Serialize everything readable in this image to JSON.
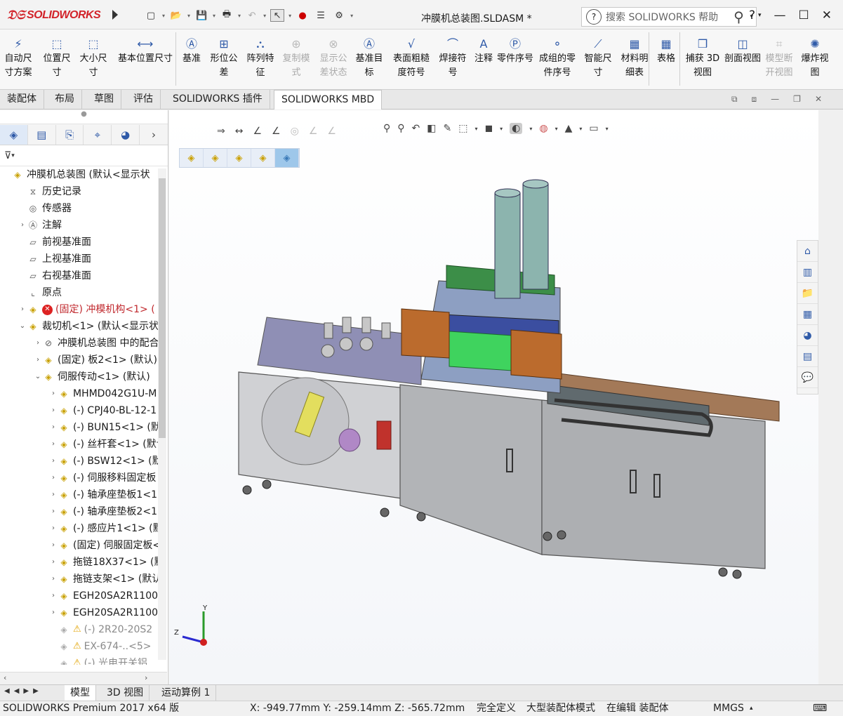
{
  "app": {
    "logo": "SOLIDWORKS",
    "doc_title": "冲膜机总装图.SLDASM *"
  },
  "search": {
    "placeholder": "搜索 SOLIDWORKS 帮助"
  },
  "ribbon": [
    {
      "label": "自动尺寸方案",
      "icon": "auto-dimension-icon",
      "enabled": true
    },
    {
      "label": "位置尺寸",
      "icon": "location-dimension-icon",
      "enabled": true
    },
    {
      "label": "大小尺寸",
      "icon": "size-dimension-icon",
      "enabled": true
    },
    {
      "label": "基本位置尺寸",
      "icon": "basic-location-dimension-icon",
      "enabled": true
    },
    {
      "label": "基准",
      "icon": "datum-icon",
      "enabled": true
    },
    {
      "label": "形位公差",
      "icon": "gtol-icon",
      "enabled": true
    },
    {
      "label": "阵列特征",
      "icon": "pattern-feature-icon",
      "enabled": true
    },
    {
      "label": "复制模式",
      "icon": "copy-scheme-icon",
      "enabled": false
    },
    {
      "label": "显示公差状态",
      "icon": "show-tolerance-status-icon",
      "enabled": false
    },
    {
      "label": "基准目标",
      "icon": "datum-target-icon",
      "enabled": true
    },
    {
      "label": "表面粗糙度符号",
      "icon": "surface-finish-icon",
      "enabled": true
    },
    {
      "label": "焊接符号",
      "icon": "weld-symbol-icon",
      "enabled": true
    },
    {
      "label": "注释",
      "icon": "note-icon",
      "enabled": true
    },
    {
      "label": "零件序号",
      "icon": "balloon-icon",
      "enabled": true
    },
    {
      "label": "成组的零件序号",
      "icon": "stacked-balloon-icon",
      "enabled": true
    },
    {
      "label": "智能尺寸",
      "icon": "smart-dimension-icon",
      "enabled": true
    },
    {
      "label": "材料明细表",
      "icon": "bom-icon",
      "enabled": true
    },
    {
      "label": "表格",
      "icon": "table-icon",
      "enabled": true
    },
    {
      "label": "捕获 3D 视图",
      "icon": "capture-3d-view-icon",
      "enabled": true
    },
    {
      "label": "剖面视图",
      "icon": "section-view-icon",
      "enabled": true
    },
    {
      "label": "模型断开视图",
      "icon": "model-break-view-icon",
      "enabled": false
    },
    {
      "label": "爆炸视图",
      "icon": "exploded-view-icon",
      "enabled": true
    }
  ],
  "tabs": [
    "装配体",
    "布局",
    "草图",
    "评估",
    "SOLIDWORKS 插件",
    "SOLIDWORKS MBD"
  ],
  "active_tab": "SOLIDWORKS MBD",
  "tree": [
    {
      "label": "冲膜机总装图 (默认<显示状",
      "indent": 0,
      "icon": "assembly-icon",
      "style": "normal",
      "expander": ""
    },
    {
      "label": "历史记录",
      "indent": 1,
      "icon": "history-icon",
      "style": "normal",
      "expander": ""
    },
    {
      "label": "传感器",
      "indent": 1,
      "icon": "sensor-icon",
      "style": "normal",
      "expander": ""
    },
    {
      "label": "注解",
      "indent": 1,
      "icon": "annotation-icon",
      "style": "normal",
      "expander": "›"
    },
    {
      "label": "前视基准面",
      "indent": 1,
      "icon": "plane-icon",
      "style": "normal",
      "expander": ""
    },
    {
      "label": "上视基准面",
      "indent": 1,
      "icon": "plane-icon",
      "style": "normal",
      "expander": ""
    },
    {
      "label": "右视基准面",
      "indent": 1,
      "icon": "plane-icon",
      "style": "normal",
      "expander": ""
    },
    {
      "label": "原点",
      "indent": 1,
      "icon": "origin-icon",
      "style": "normal",
      "expander": ""
    },
    {
      "label": "(固定) 冲模机构<1> (",
      "indent": 1,
      "icon": "error-icon",
      "style": "red",
      "expander": "›"
    },
    {
      "label": "裁切机<1> (默认<显示状",
      "indent": 1,
      "icon": "assembly-icon",
      "style": "normal",
      "expander": "⌄"
    },
    {
      "label": "冲膜机总装图 中的配合",
      "indent": 2,
      "icon": "mates-icon",
      "style": "normal",
      "expander": "›"
    },
    {
      "label": "(固定) 板2<1> (默认)",
      "indent": 2,
      "icon": "part-icon",
      "style": "normal",
      "expander": "›"
    },
    {
      "label": "伺服传动<1> (默认)",
      "indent": 2,
      "icon": "assembly-icon",
      "style": "normal",
      "expander": "⌄"
    },
    {
      "label": "MHMD042G1U-M",
      "indent": 3,
      "icon": "part-icon",
      "style": "normal",
      "expander": "›"
    },
    {
      "label": "(-) CPJ40-BL-12-1",
      "indent": 3,
      "icon": "part-icon",
      "style": "normal",
      "expander": "›"
    },
    {
      "label": "(-) BUN15<1> (默",
      "indent": 3,
      "icon": "part-icon",
      "style": "normal",
      "expander": "›"
    },
    {
      "label": "(-) 丝杆套<1> (默认",
      "indent": 3,
      "icon": "part-icon",
      "style": "normal",
      "expander": "›"
    },
    {
      "label": "(-) BSW12<1> (默",
      "indent": 3,
      "icon": "part-icon",
      "style": "normal",
      "expander": "›"
    },
    {
      "label": "(-) 伺服移料固定板",
      "indent": 3,
      "icon": "part-icon",
      "style": "normal",
      "expander": "›"
    },
    {
      "label": "(-) 轴承座垫板1<1",
      "indent": 3,
      "icon": "part-icon",
      "style": "normal",
      "expander": "›"
    },
    {
      "label": "(-) 轴承座垫板2<1",
      "indent": 3,
      "icon": "part-icon",
      "style": "normal",
      "expander": "›"
    },
    {
      "label": "(-) 感应片1<1> (默",
      "indent": 3,
      "icon": "part-icon",
      "style": "normal",
      "expander": "›"
    },
    {
      "label": "(固定) 伺服固定板<",
      "indent": 3,
      "icon": "part-icon",
      "style": "normal",
      "expander": "›"
    },
    {
      "label": "拖链18X37<1> (默",
      "indent": 3,
      "icon": "part-icon",
      "style": "normal",
      "expander": "›"
    },
    {
      "label": "拖链支架<1> (默认",
      "indent": 3,
      "icon": "part-icon",
      "style": "normal",
      "expander": "›"
    },
    {
      "label": "EGH20SA2R1100",
      "indent": 3,
      "icon": "part-icon",
      "style": "normal",
      "expander": "›"
    },
    {
      "label": "EGH20SA2R1100",
      "indent": 3,
      "icon": "part-icon",
      "style": "normal",
      "expander": "›"
    },
    {
      "label": "(-) 2R20-20S2",
      "indent": 3,
      "icon": "warning-icon",
      "style": "gray",
      "expander": ""
    },
    {
      "label": "EX-674-..<5>",
      "indent": 3,
      "icon": "warning-icon",
      "style": "gray",
      "expander": ""
    },
    {
      "label": "(-) 光电开关铝",
      "indent": 3,
      "icon": "warning-icon",
      "style": "gray",
      "expander": ""
    }
  ],
  "bottom_tabs": [
    "模型",
    "3D 视图",
    "运动算例 1"
  ],
  "active_bottom_tab": "模型",
  "status": {
    "product": "SOLIDWORKS Premium 2017 x64 版",
    "coords": "X: -949.77mm Y: -259.14mm Z: -565.72mm",
    "definition": "完全定义",
    "mode": "大型装配体模式",
    "editing": "在编辑 装配体",
    "units": "MMGS"
  },
  "triad": {
    "y": "Y",
    "z": "Z"
  },
  "colors": {
    "brand": "#d2232a",
    "active_tab": "#ffffff",
    "machine_gray": "#a9abae"
  }
}
